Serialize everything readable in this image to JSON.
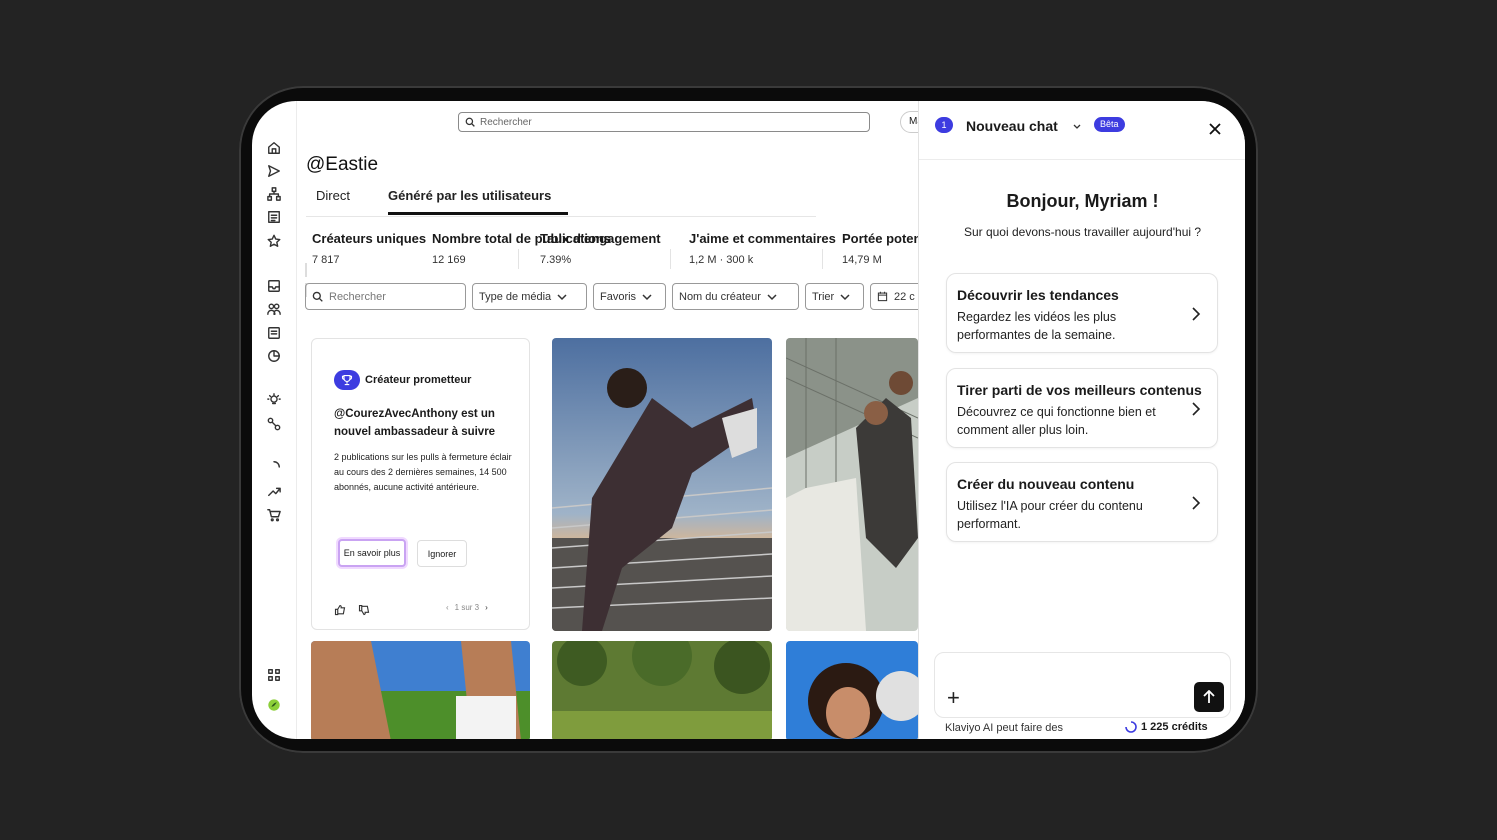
{
  "search": {
    "placeholder": "Rechercher"
  },
  "top_button": {
    "label": "Ma"
  },
  "page": {
    "title": "@Eastie"
  },
  "tabs": [
    {
      "label": "Direct"
    },
    {
      "label": "Généré par les utilisateurs"
    }
  ],
  "stats": [
    {
      "label": "Créateurs uniques",
      "value": "7 817"
    },
    {
      "label": "Nombre total de publications",
      "value": "12 169"
    },
    {
      "label": "Taux d'engagement",
      "value": "7.39%"
    },
    {
      "label": "J'aime et commentaires",
      "value": "1,2 M · 300 k"
    },
    {
      "label": "Portée potentielle",
      "value": "14,79 M"
    }
  ],
  "filters": {
    "search_placeholder": "Rechercher",
    "media_type": "Type de média",
    "favorites": "Favoris",
    "creator_name": "Nom du créateur",
    "sort": "Trier",
    "date": "22 c"
  },
  "card": {
    "badge_title": "Créateur prometteur",
    "headline": "@CourezAvecAnthony est un nouvel ambassadeur à suivre",
    "body": "2 publications sur les pulls à fermeture éclair au cours des 2 dernières semaines, 14 500 abonnés, aucune activité antérieure.",
    "primary_button": "En savoir plus",
    "secondary_button": "Ignorer",
    "pager": "1 sur 3"
  },
  "chat": {
    "count": "1",
    "title": "Nouveau chat",
    "beta": "Bêta",
    "greeting": "Bonjour, Myriam !",
    "subtitle": "Sur quoi devons-nous travailler aujourd'hui ?",
    "suggestions": [
      {
        "title": "Découvrir les tendances",
        "desc": "Regardez les vidéos les plus performantes de la semaine."
      },
      {
        "title": "Tirer parti de vos meilleurs contenus",
        "desc": "Découvrez ce qui fonctionne bien et comment aller plus loin."
      },
      {
        "title": "Créer du nouveau contenu",
        "desc": "Utilisez l'IA pour créer du contenu performant."
      }
    ],
    "footer_note": "Klaviyo AI peut faire des",
    "credits": "1 225 crédits"
  },
  "colors": {
    "accent": "#3d3ce0",
    "background": "#232323",
    "bezel": "#0b0b0b"
  }
}
